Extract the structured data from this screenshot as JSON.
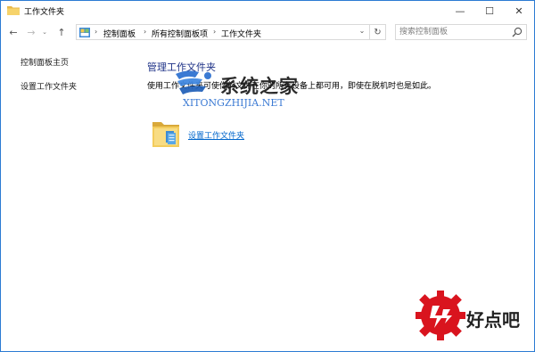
{
  "window": {
    "title": "工作文件夹",
    "buttons": {
      "minimize": "—",
      "maximize": "☐",
      "close": "✕"
    }
  },
  "nav": {
    "back": "←",
    "forward": "→",
    "recent": "⌄",
    "up": "↑",
    "breadcrumb": [
      "控制面板",
      "所有控制面板项",
      "工作文件夹"
    ],
    "separator": "›",
    "dropdown": "⌄",
    "refresh": "↻"
  },
  "search": {
    "placeholder": "搜索控制面板"
  },
  "sidebar": {
    "items": [
      {
        "label": "控制面板主页"
      },
      {
        "label": "设置工作文件夹"
      }
    ]
  },
  "main": {
    "heading": "管理工作文件夹",
    "description": "使用工作文件夹可使你的文件在你的所有设备上都可用，即使在脱机时也是如此。",
    "setup_link": "设置工作文件夹"
  },
  "watermarks": {
    "site1_name": "系统之家",
    "site1_url": "XITONGZHIJIA.NET",
    "site2_name": "好点吧"
  },
  "colors": {
    "window_border": "#2b7bd3",
    "heading": "#1e3287",
    "link": "#0066cc",
    "logo_red": "#d9141e"
  }
}
